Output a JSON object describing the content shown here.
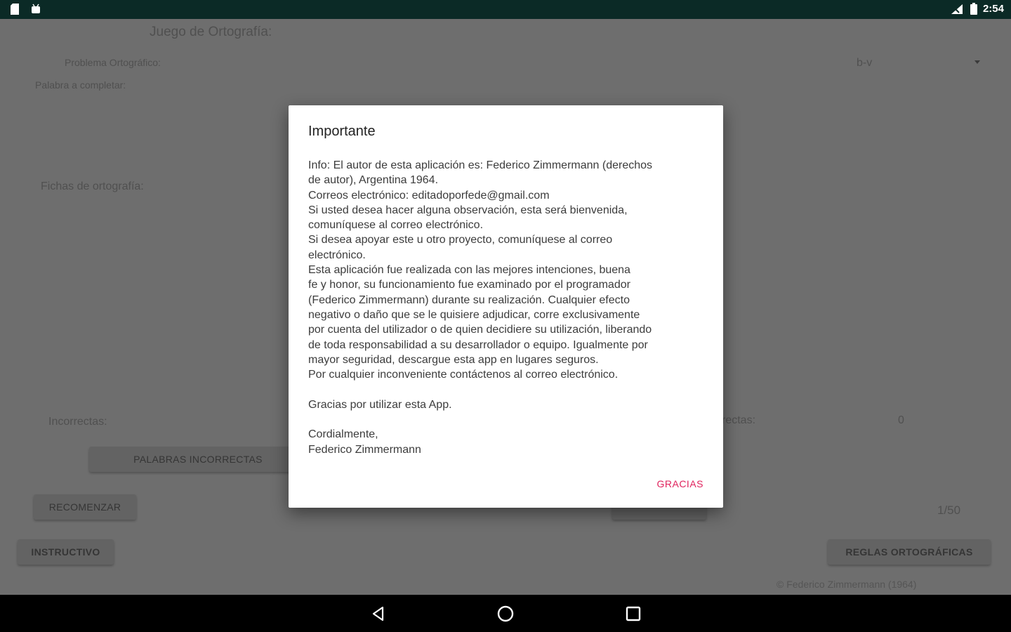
{
  "status_bar": {
    "time": "2:54",
    "left_icons": [
      "sd-card-icon",
      "android-icon"
    ],
    "right_icons": [
      "signal-icon",
      "battery-icon"
    ]
  },
  "app": {
    "title": "Juego de Ortografía:",
    "problem_label": "Problema Ortográfico:",
    "problem_value": "b-v",
    "word_label": "Palabra a completar:",
    "cards_label": "Fichas de ortografía:",
    "incorrect_label": "Incorrectas:",
    "correct_label": "rectas:",
    "correct_value": "0",
    "counter": "1/50",
    "buttons": {
      "incorrect_words": "PALABRAS INCORRECTAS",
      "restart": "RECOMENZAR",
      "check": "",
      "instructions": "INSTRUCTIVO",
      "rules": "REGLAS ORTOGRÁFICAS"
    },
    "copyright": "© Federico Zimmermann (1964)"
  },
  "dialog": {
    "title": "Importante",
    "lines": [
      "Info: El autor de esta aplicación es: Federico Zimmermann (derechos",
      "de autor), Argentina 1964.",
      "Correos electrónico: editadoporfede@gmail.com",
      "Si usted desea hacer alguna observación, esta será bienvenida,",
      "comuníquese al correo electrónico.",
      "Si desea apoyar este u otro proyecto, comuníquese al correo",
      "electrónico.",
      "Esta aplicación fue realizada con las mejores intenciones, buena",
      "fe y honor, su funcionamiento fue examinado por el programador",
      "(Federico Zimmermann) durante su realización. Cualquier efecto",
      "negativo o daño que se le quisiere adjudicar, corre exclusivamente",
      "por cuenta del utilizador o de quien decidiere su utilización, liberando",
      "de toda responsabilidad a su desarrollador o equipo. Igualmente por",
      "mayor seguridad, descargue esta app en lugares seguros.",
      "Por cualquier inconveniente contáctenos al correo electrónico.",
      "",
      "Gracias por utilizar esta App.",
      "",
      "Cordialmente,",
      "Federico Zimmermann"
    ],
    "button": "GRACIAS",
    "accent_color": "#e0245e"
  },
  "nav_bar": {
    "icons": [
      "back-icon",
      "home-icon",
      "recents-icon"
    ]
  }
}
